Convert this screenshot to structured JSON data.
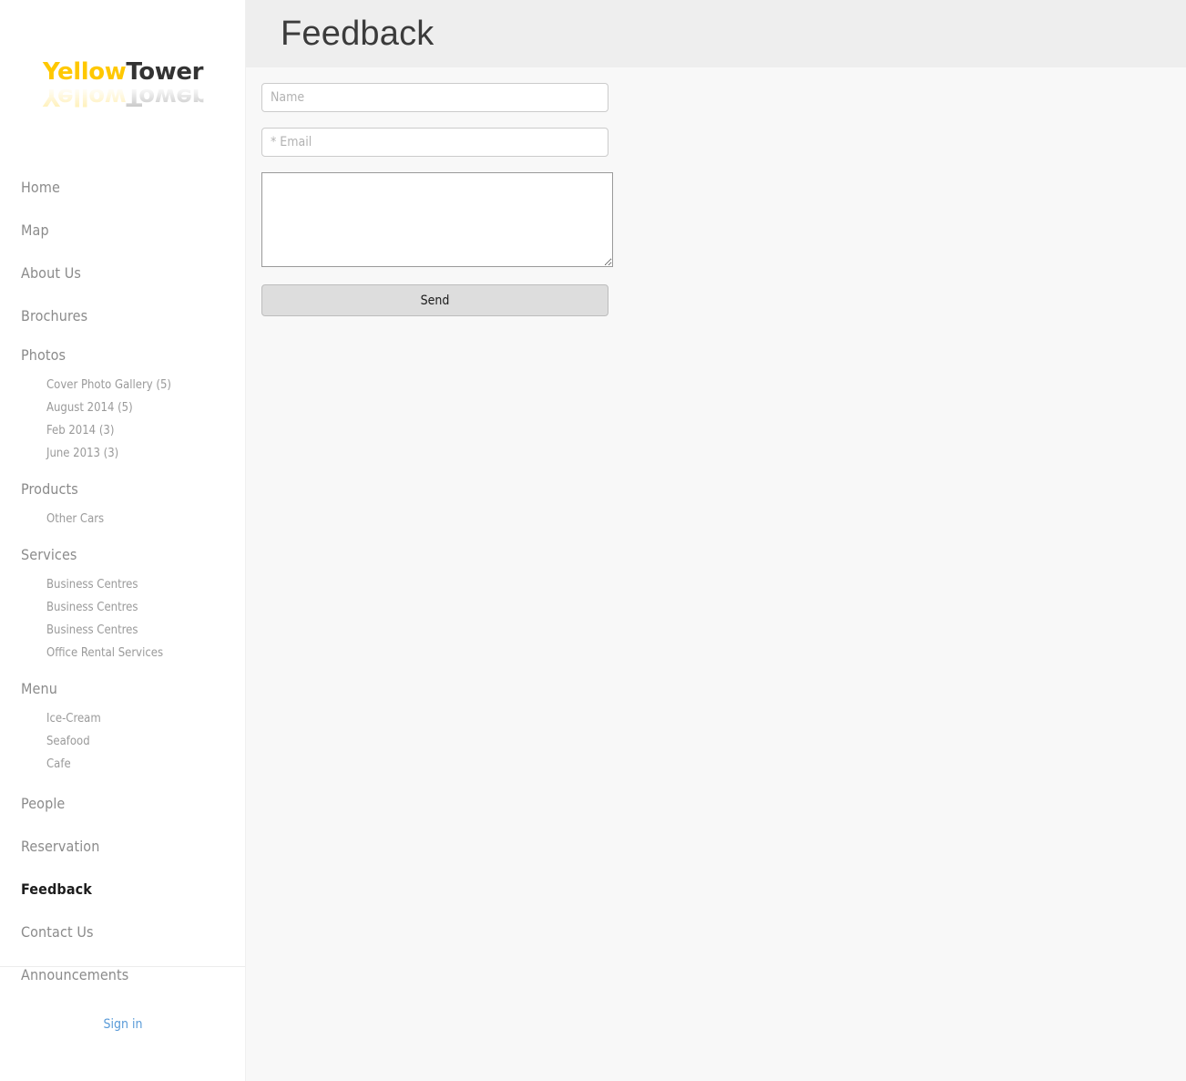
{
  "logo": {
    "part1": "Yellow",
    "part2": "Tower",
    "color_yellow": "#ffc800",
    "color_dark": "#333333"
  },
  "sidebar": {
    "nav": [
      {
        "label": "Home",
        "active": false,
        "children": []
      },
      {
        "label": "Map",
        "active": false,
        "children": []
      },
      {
        "label": "About Us",
        "active": false,
        "children": []
      },
      {
        "label": "Brochures",
        "active": false,
        "children": []
      },
      {
        "label": "Photos",
        "active": false,
        "children": [
          {
            "label": "Cover Photo Gallery (5)"
          },
          {
            "label": "August 2014 (5)"
          },
          {
            "label": "Feb 2014 (3)"
          },
          {
            "label": "June 2013 (3)"
          }
        ]
      },
      {
        "label": "Products",
        "active": false,
        "children": [
          {
            "label": "Other Cars"
          }
        ]
      },
      {
        "label": "Services",
        "active": false,
        "children": [
          {
            "label": "Business Centres"
          },
          {
            "label": "Business Centres"
          },
          {
            "label": "Business Centres"
          },
          {
            "label": "Office Rental Services"
          }
        ]
      },
      {
        "label": "Menu",
        "active": false,
        "children": [
          {
            "label": "Ice-Cream"
          },
          {
            "label": "Seafood"
          },
          {
            "label": "Cafe"
          }
        ]
      },
      {
        "label": "People",
        "active": false,
        "children": []
      },
      {
        "label": "Reservation",
        "active": false,
        "children": []
      },
      {
        "label": "Feedback",
        "active": true,
        "children": []
      },
      {
        "label": "Contact Us",
        "active": false,
        "children": []
      },
      {
        "label": "Announcements",
        "active": false,
        "children": []
      }
    ],
    "signin_label": "Sign in",
    "signin_color": "#5a9bd8"
  },
  "header": {
    "title": "Feedback",
    "background": "#eeeeee"
  },
  "form": {
    "name_value": "",
    "name_placeholder": "Name",
    "email_value": "",
    "email_placeholder": "* Email",
    "message_value": "",
    "message_placeholder": "",
    "send_label": "Send"
  }
}
